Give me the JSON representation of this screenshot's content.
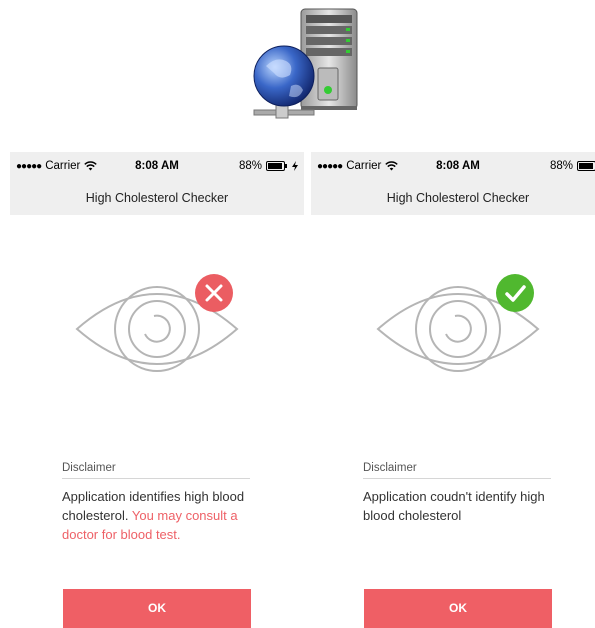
{
  "screens": [
    {
      "status": {
        "carrier": "Carrier",
        "time": "8:08 AM",
        "battery": "88%"
      },
      "nav_title": "High Cholesterol Checker",
      "result": "error",
      "disclaimer_label": "Disclaimer",
      "message_plain": "Application identifies high blood cholesterol. ",
      "message_highlight": "You may consult a doctor for blood test.",
      "button_label": "OK"
    },
    {
      "status": {
        "carrier": "Carrier",
        "time": "8:08 AM",
        "battery": "88%"
      },
      "nav_title": "High Cholesterol Checker",
      "result": "success",
      "disclaimer_label": "Disclaimer",
      "message_plain": "Application coudn't identify high blood cholesterol",
      "message_highlight": "",
      "button_label": "OK"
    }
  ],
  "colors": {
    "accent": "#ef5f65",
    "error_badge": "#eb5d62",
    "success_badge": "#50b82f",
    "bar_bg": "#efefef"
  },
  "icons": {
    "header": "server-globe-icon",
    "eye": "eye-icon",
    "error": "x-icon",
    "success": "checkmark-icon"
  }
}
